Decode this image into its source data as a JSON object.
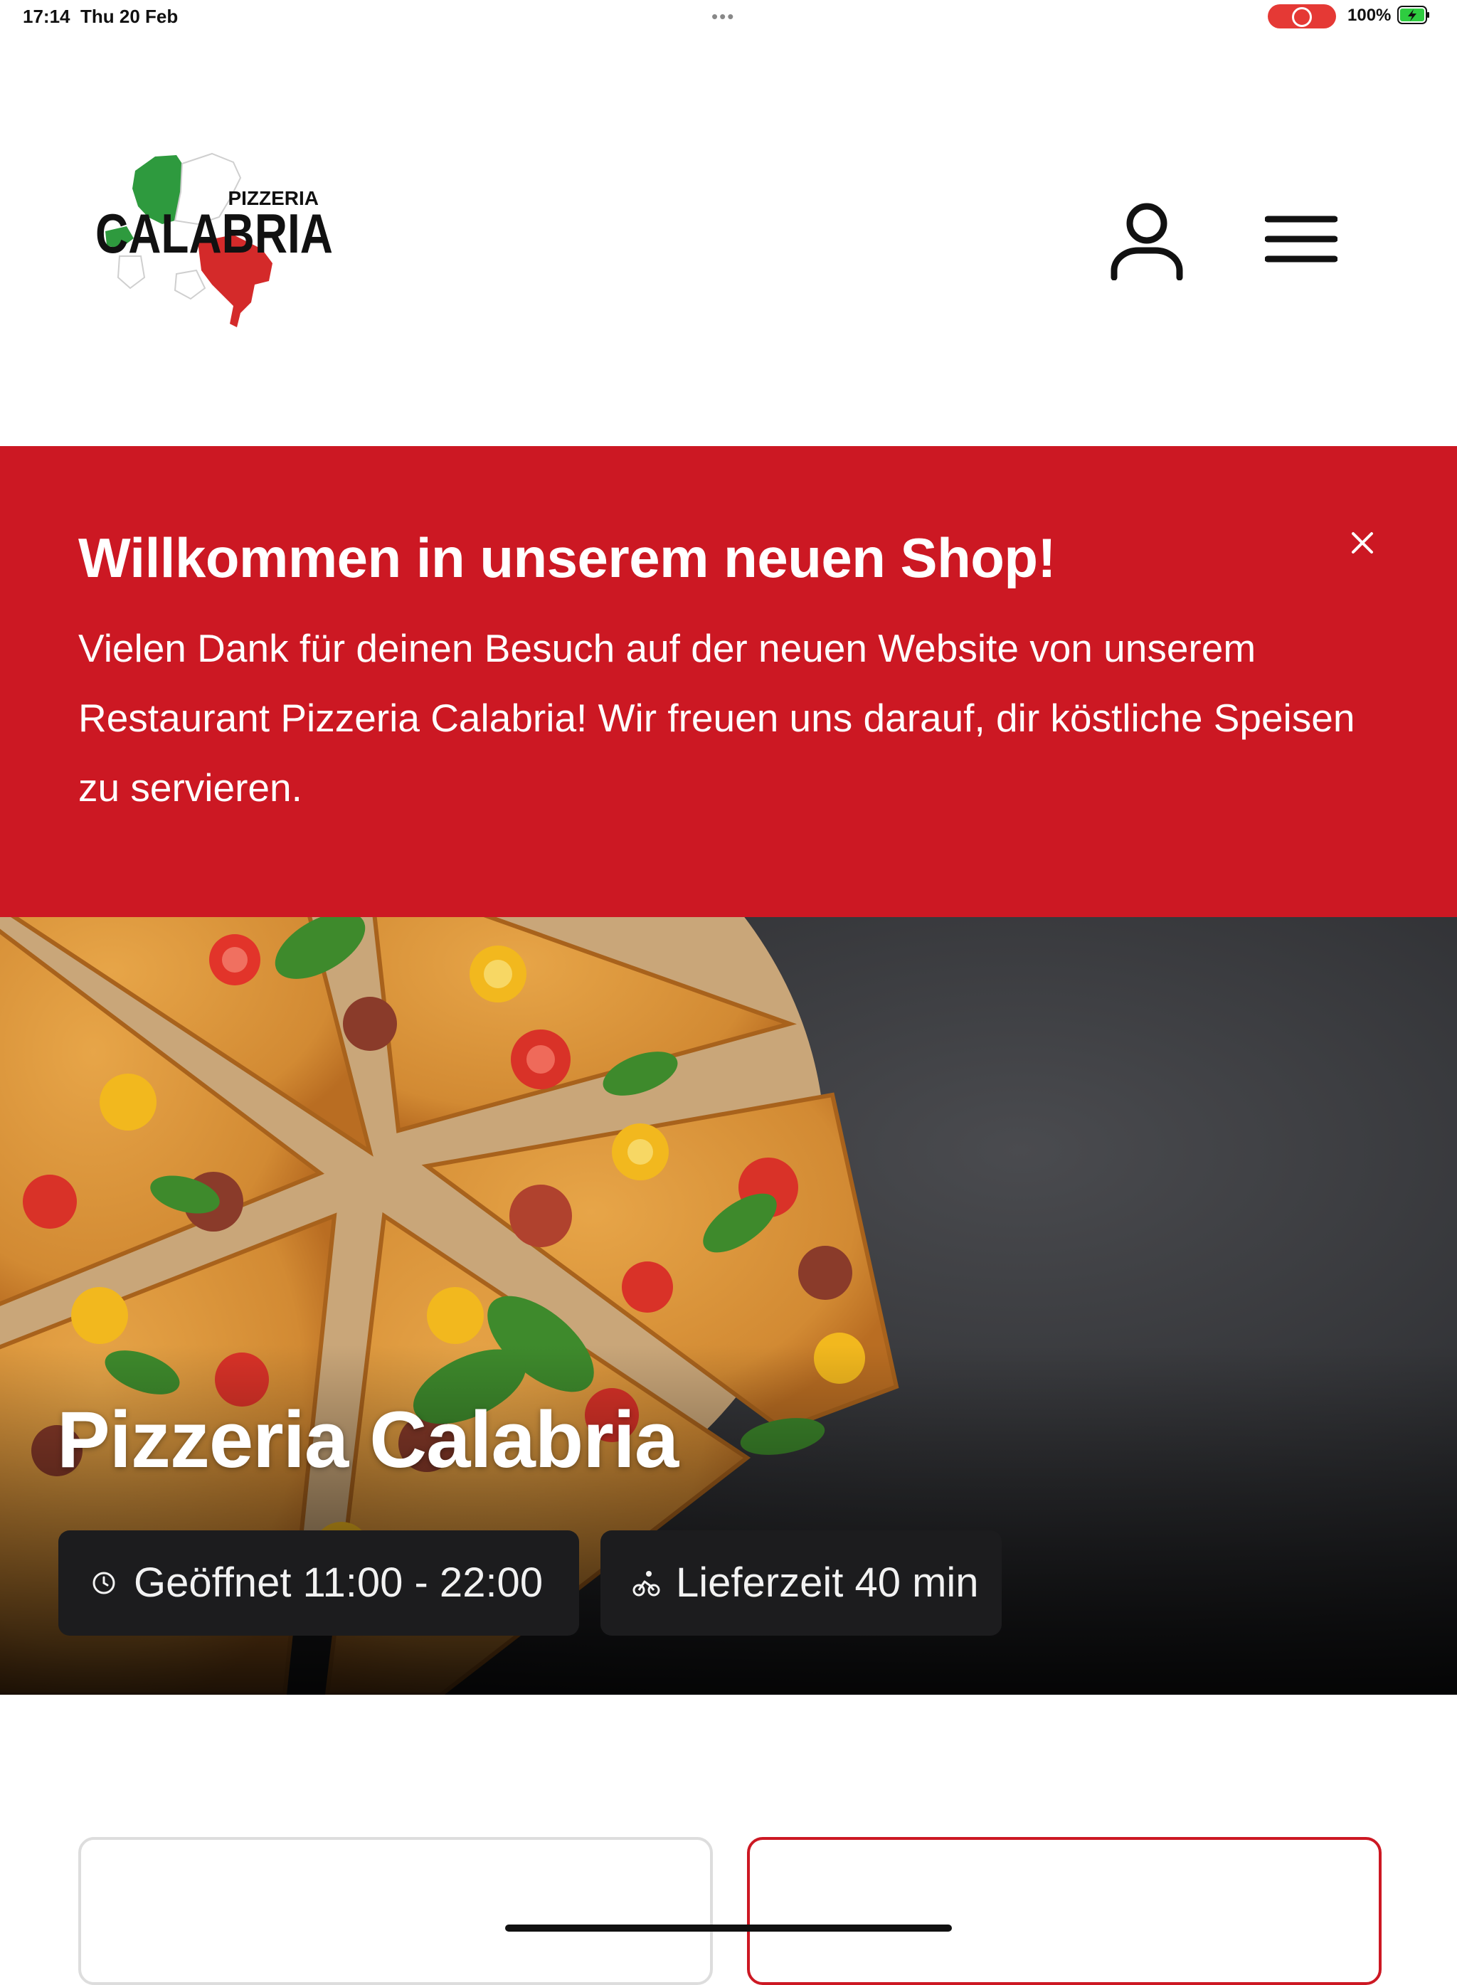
{
  "status_bar": {
    "time": "17:14",
    "date": "Thu 20 Feb",
    "multitask": "•••",
    "battery": "100%"
  },
  "header": {
    "logo_small": "PIZZERIA",
    "logo_big": "CALABRIA",
    "account_icon": "user-icon",
    "menu_icon": "hamburger-menu-icon"
  },
  "banner": {
    "title": "Willkommen in unserem neuen Shop!",
    "text": "Vielen Dank für deinen Besuch auf der neuen Website von unserem Restaurant Pizzeria Calabria! Wir freuen uns darauf, dir köstliche Speisen zu servieren.",
    "background": "#cc1823",
    "close_icon": "close-icon"
  },
  "hero": {
    "title": "Pizzeria Calabria",
    "open_hours": "Geöffnet 11:00 - 22:00",
    "delivery_time": "Lieferzeit 40 min",
    "open_icon": "clock-icon",
    "delivery_icon": "bicycle-icon"
  },
  "colors": {
    "accent": "#cc1823",
    "chip_bg": "#1c1c1e"
  }
}
